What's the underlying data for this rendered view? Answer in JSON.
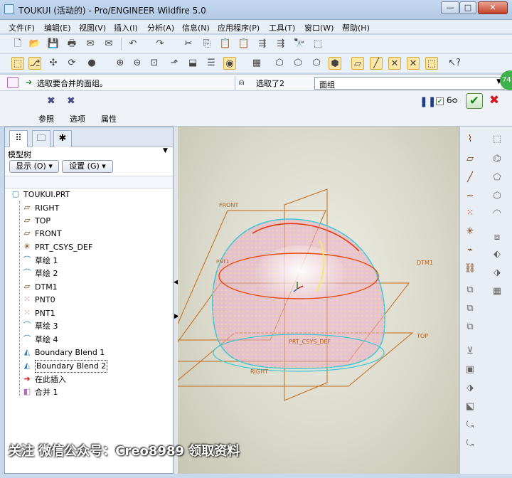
{
  "window": {
    "title": "TOUKUI (活动的) - Pro/ENGINEER Wildfire 5.0",
    "min": "—",
    "max": "□",
    "close": "✕"
  },
  "menu": [
    "文件(F)",
    "编辑(E)",
    "视图(V)",
    "插入(I)",
    "分析(A)",
    "信息(N)",
    "应用程序(P)",
    "工具(T)",
    "窗口(W)",
    "帮助(H)"
  ],
  "prompt": {
    "message": "选取要合并的面组。",
    "selection": "选取了2",
    "filter": "面组",
    "badge": "74"
  },
  "dashboard": {
    "tabs": [
      "参照",
      "选项",
      "属性"
    ]
  },
  "model_tree": {
    "title": "模型树",
    "show_button": "显示 (O) ▾",
    "settings_button": "设置 (G) ▾",
    "root": "TOUKUI.PRT",
    "items": [
      {
        "label": "RIGHT",
        "icon": "datum-plane-icon"
      },
      {
        "label": "TOP",
        "icon": "datum-plane-icon"
      },
      {
        "label": "FRONT",
        "icon": "datum-plane-icon"
      },
      {
        "label": "PRT_CSYS_DEF",
        "icon": "csys-icon"
      },
      {
        "label": "草绘 1",
        "icon": "sketch-icon"
      },
      {
        "label": "草绘 2",
        "icon": "sketch-icon"
      },
      {
        "label": "DTM1",
        "icon": "datum-plane-icon"
      },
      {
        "label": "PNT0",
        "icon": "datum-point-icon"
      },
      {
        "label": "PNT1",
        "icon": "datum-point-icon"
      },
      {
        "label": "草绘 3",
        "icon": "sketch-icon"
      },
      {
        "label": "草绘 4",
        "icon": "sketch-icon"
      },
      {
        "label": "Boundary Blend 1",
        "icon": "boundary-blend-icon"
      },
      {
        "label": "Boundary Blend 2",
        "icon": "boundary-blend-icon"
      },
      {
        "label": "在此插入",
        "icon": "insert-here-icon"
      },
      {
        "label": "合并 1",
        "icon": "merge-icon"
      }
    ]
  },
  "viewport": {
    "labels": {
      "front": "FRONT",
      "dtm1": "DTM1",
      "top": "TOP",
      "csys": "PRT_CSYS_DEF",
      "right": "RIGHT",
      "pnt": "PNT1"
    }
  },
  "watermark": "关注 微信公众号：Creo8989 领取资料",
  "colors": {
    "accent": "#2f6fb5",
    "datum": "#c06a1a",
    "surface": "#e9a9c9",
    "edge": "#3ec6d6",
    "highlight": "#e03a10"
  }
}
